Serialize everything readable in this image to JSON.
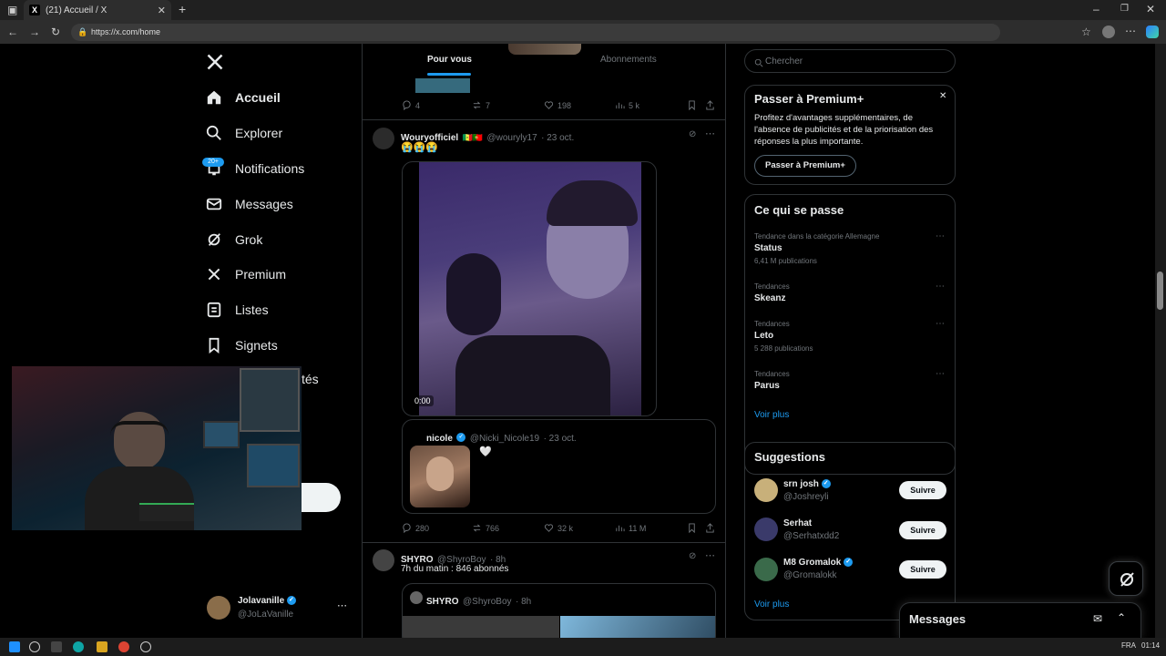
{
  "browser": {
    "tab_title": "(21) Accueil / X",
    "url": "https://x.com/home"
  },
  "nav": {
    "items": [
      {
        "label": "Accueil",
        "icon": "home-icon"
      },
      {
        "label": "Explorer",
        "icon": "search-icon"
      },
      {
        "label": "Notifications",
        "icon": "bell-icon",
        "badge": "20+"
      },
      {
        "label": "Messages",
        "icon": "mail-icon"
      },
      {
        "label": "Grok",
        "icon": "grok-icon"
      },
      {
        "label": "Premium",
        "icon": "x-logo-icon"
      },
      {
        "label": "Listes",
        "icon": "list-icon"
      },
      {
        "label": "Signets",
        "icon": "bookmark-icon"
      }
    ],
    "partial_item_fragment": "tés",
    "profile": {
      "name": "Jolavanille",
      "handle": "@JoLaVanille"
    }
  },
  "feed": {
    "tabs": [
      {
        "label": "Pour vous",
        "active": true
      },
      {
        "label": "Abonnements",
        "active": false
      }
    ],
    "top_metrics": {
      "replies": "4",
      "reposts": "7",
      "likes": "198",
      "views": "5 k"
    },
    "tweet1": {
      "name": "Wouryofficiel",
      "handle": "@wouryly17",
      "date": "· 23 oct.",
      "text": "😭😭😭",
      "video_time": "0:00",
      "quote": {
        "name": "nicole",
        "handle": "@Nicki_Nicole19",
        "date": "· 23 oct.",
        "text": "🤍"
      },
      "metrics": {
        "replies": "280",
        "reposts": "766",
        "likes": "32 k",
        "views": "11 M"
      }
    },
    "tweet2": {
      "name": "SHYRO",
      "handle": "@ShyroBoy",
      "date": "· 8h",
      "text": "7h du matin : 846 abonnés",
      "quote": {
        "name": "SHYRO",
        "handle": "@ShyroBoy",
        "date": "· 8h"
      }
    }
  },
  "sidebar": {
    "search_placeholder": "Chercher",
    "premium": {
      "title": "Passer à Premium+",
      "body": "Profitez d'avantages supplémentaires, de l'absence de publicités et de la priorisation des réponses la plus importante.",
      "button": "Passer à Premium+"
    },
    "trends": {
      "title": "Ce qui se passe",
      "items": [
        {
          "meta": "Tendance dans la catégorie Allemagne",
          "title": "Status",
          "count": "6,41 M publications"
        },
        {
          "meta": "Tendances",
          "title": "Skeanz",
          "count": ""
        },
        {
          "meta": "Tendances",
          "title": "Leto",
          "count": "5 288 publications"
        },
        {
          "meta": "Tendances",
          "title": "Parus",
          "count": ""
        }
      ],
      "more": "Voir plus"
    },
    "suggestions": {
      "title": "Suggestions",
      "items": [
        {
          "name": "srn josh",
          "handle": "@Joshreyli",
          "button": "Suivre",
          "verified": true
        },
        {
          "name": "Serhat",
          "handle": "@Serhatxdd2",
          "button": "Suivre",
          "verified": false
        },
        {
          "name": "M8 Gromalok",
          "handle": "@Gromalokk",
          "button": "Suivre",
          "verified": true
        }
      ],
      "more": "Voir plus"
    }
  },
  "messages_drawer": {
    "title": "Messages"
  },
  "taskbar": {
    "lang": "FRA",
    "time": "01:14"
  },
  "colors": {
    "accent": "#1d9bf0",
    "background": "#000000",
    "border": "#2f3336",
    "muted": "#71767b"
  }
}
